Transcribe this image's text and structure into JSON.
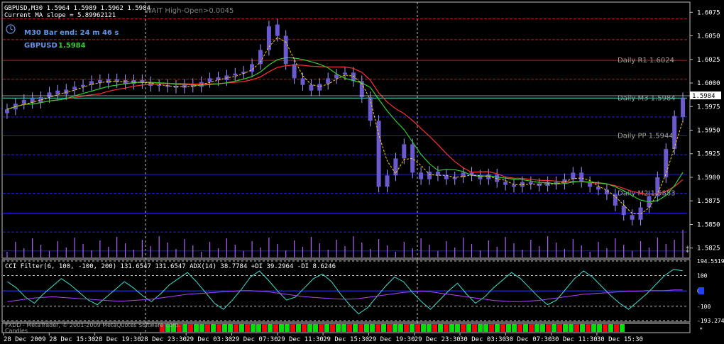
{
  "header": {
    "symbol_line": "GBPUSD,M30  1.5964 1.5989 1.5962 1.5984",
    "ma_line": "Current MA slope = 5.89962121",
    "bar_end": "M30 Bar end: 24 m 46 s",
    "symbol": "GBPUSD",
    "price": "1.5984",
    "wait_text": "WAIT High-Open>0.0045"
  },
  "overlay_bottom": {
    "line1": "FXDD - MetaTrader, © 2001-2009 MetaQuotes Software Corp.",
    "line2": "Candles"
  },
  "colors": {
    "background": "#000000",
    "bull": "#6a5acd",
    "bear": "#6a5acd",
    "ma_slow": "#ff3030",
    "ma_fast": "#32cd32",
    "ma_dash": "#ffd700",
    "pivot_pp": "#40e0d0",
    "resist": "#b22222",
    "support": "#2020d0",
    "volume": "#b060ff",
    "cci": "#40e0d0",
    "adx": "#b040ff",
    "grid": "#c0c0c0"
  },
  "chart_data": [
    {
      "type": "candlestick",
      "title": "GBPUSD,M30",
      "ylim": [
        1.5815,
        1.6085
      ],
      "y_ticks": [
        "1.6075",
        "1.6050",
        "1.6025",
        "1.6000",
        "1.5975",
        "1.5950",
        "1.5925",
        "1.5900",
        "1.5875",
        "1.5850",
        "1.5825"
      ],
      "current_price_label": "1.5984",
      "x_ticks": [
        "28 Dec 2009",
        "28 Dec 15:30",
        "28 Dec 19:30",
        "28 Dec 23:30",
        "29 Dec 03:30",
        "29 Dec 07:30",
        "29 Dec 11:30",
        "29 Dec 15:30",
        "29 Dec 19:30",
        "29 Dec 23:30",
        "30 Dec 03:30",
        "30 Dec 07:30",
        "30 Dec 11:30",
        "30 Dec 15:30"
      ],
      "pivot_labels": [
        {
          "text": "Daily R1 1.6024",
          "price": 1.6024
        },
        {
          "text": "Daily M3 1.5984",
          "price": 1.5984
        },
        {
          "text": "Daily PP 1.5944",
          "price": 1.5944
        },
        {
          "text": "Daily M2 1.5883",
          "price": 1.5883
        }
      ],
      "series": [
        {
          "name": "close",
          "values": [
            1.5972,
            1.5978,
            1.5982,
            1.5979,
            1.5985,
            1.599,
            1.5988,
            1.5993,
            1.5996,
            1.5998,
            1.6002,
            1.6,
            1.6004,
            1.6001,
            1.5999,
            1.6003,
            1.6,
            1.5997,
            1.5998,
            1.5996,
            1.5995,
            1.5998,
            1.5996,
            1.6001,
            1.6005,
            1.6003,
            1.6008,
            1.601,
            1.6012,
            1.602,
            1.6035,
            1.606,
            1.605,
            1.602,
            1.6005,
            1.5998,
            1.5992,
            1.5999,
            1.6005,
            1.6009,
            1.6011,
            1.6002,
            1.5985,
            1.596,
            1.589,
            1.5902,
            1.592,
            1.5935,
            1.5905,
            1.5898,
            1.5906,
            1.5902,
            1.5898,
            1.59,
            1.5905,
            1.5902,
            1.5898,
            1.5903,
            1.5895,
            1.5892,
            1.589,
            1.5895,
            1.5893,
            1.5891,
            1.5895,
            1.5893,
            1.5898,
            1.5905,
            1.5895,
            1.589,
            1.5887,
            1.5882,
            1.587,
            1.586,
            1.5855,
            1.5868,
            1.588,
            1.59,
            1.593,
            1.5965,
            1.5984
          ]
        }
      ],
      "open_values": [
        1.5968,
        1.5972,
        1.5978,
        1.5984,
        1.5979,
        1.5985,
        1.5992,
        1.5988,
        1.5993,
        1.5996,
        1.5998,
        1.6003,
        1.6,
        1.6004,
        1.6003,
        1.5999,
        1.6003,
        1.6001,
        1.5997,
        1.5998,
        1.5997,
        1.5995,
        1.5999,
        1.5996,
        1.6001,
        1.6006,
        1.6003,
        1.6008,
        1.601,
        1.6012,
        1.602,
        1.6035,
        1.6062,
        1.605,
        1.602,
        1.6005,
        1.5998,
        1.5992,
        1.5999,
        1.6005,
        1.6009,
        1.6011,
        1.6002,
        1.5985,
        1.596,
        1.589,
        1.5902,
        1.592,
        1.5935,
        1.5905,
        1.5898,
        1.5906,
        1.5902,
        1.5898,
        1.59,
        1.5905,
        1.5902,
        1.5898,
        1.5903,
        1.5895,
        1.5892,
        1.589,
        1.5895,
        1.5893,
        1.5891,
        1.5895,
        1.5893,
        1.5898,
        1.5905,
        1.5895,
        1.589,
        1.5887,
        1.5882,
        1.587,
        1.586,
        1.5855,
        1.5868,
        1.588,
        1.59,
        1.593,
        1.5964
      ]
    },
    {
      "type": "line",
      "title": "CCI Filter(6, 100, -100, 200) 131.6547 131.6547  ADX(14) 38.7784 +DI 39.2964 -DI 8.6246",
      "ylim": [
        -193.274,
        194.5519
      ],
      "y_ticks": [
        "194.5519",
        "100",
        "0",
        "-100",
        "-193.274"
      ],
      "series": [
        {
          "name": "CCI",
          "values": [
            60,
            20,
            -40,
            -80,
            -20,
            30,
            80,
            40,
            -10,
            -60,
            -90,
            -40,
            10,
            60,
            20,
            -30,
            -70,
            -20,
            40,
            80,
            120,
            60,
            -10,
            -80,
            -120,
            -60,
            10,
            90,
            130,
            70,
            0,
            -60,
            -40,
            20,
            80,
            110,
            60,
            -20,
            -90,
            -150,
            -110,
            -40,
            30,
            90,
            60,
            -10,
            -70,
            -120,
            -60,
            0,
            50,
            -20,
            -80,
            -40,
            20,
            70,
            120,
            80,
            20,
            -40,
            -90,
            -60,
            10,
            80,
            130,
            90,
            30,
            -30,
            -80,
            -120,
            -70,
            -20,
            40,
            100,
            140,
            131
          ]
        },
        {
          "name": "ADX",
          "values": [
            20,
            22,
            24,
            26,
            27,
            28,
            27,
            26,
            25,
            24,
            23,
            22,
            21,
            21,
            22,
            23,
            24,
            26,
            28,
            30,
            32,
            33,
            34,
            35,
            36,
            37,
            38,
            38,
            37,
            36,
            34,
            32,
            30,
            28,
            27,
            26,
            25,
            24,
            24,
            25,
            27,
            29,
            31,
            33,
            35,
            36,
            37,
            36,
            34,
            32,
            30,
            28,
            26,
            24,
            22,
            21,
            20,
            20,
            21,
            22,
            24,
            26,
            28,
            30,
            32,
            33,
            34,
            35,
            36,
            37,
            37,
            38,
            38,
            38,
            39,
            39
          ]
        }
      ]
    }
  ]
}
